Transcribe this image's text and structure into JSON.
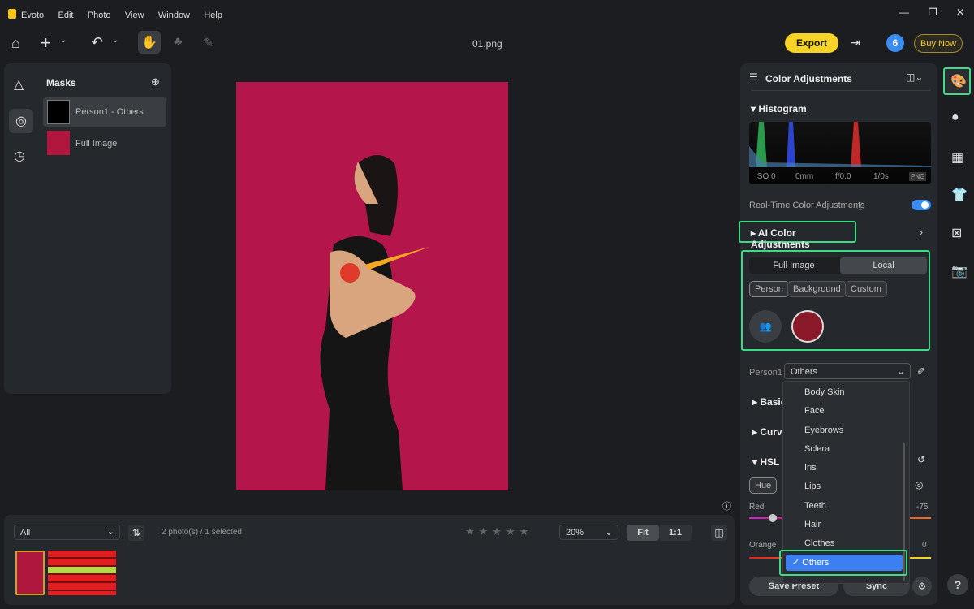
{
  "app": {
    "name": "Evoto",
    "menu": [
      "Edit",
      "Photo",
      "View",
      "Window",
      "Help"
    ],
    "file_name": "01.png"
  },
  "toolbar": {
    "export": "Export",
    "badge": "6",
    "buy_now": "Buy Now",
    "accent": "#f5d327"
  },
  "masks": {
    "title": "Masks",
    "items": [
      {
        "label": "Person1 - Others",
        "selected": true
      },
      {
        "label": "Full Image",
        "selected": false
      }
    ]
  },
  "filmstrip": {
    "filter": "All",
    "count": "2 photo(s) / 1 selected",
    "rating": 0,
    "zoom": "20%",
    "fit": "Fit",
    "one_to_one": "1:1"
  },
  "right": {
    "title": "Color Adjustments",
    "histogram": "Histogram",
    "exif": [
      "ISO 0",
      "0mm",
      "f/0.0",
      "1/0s"
    ],
    "format": "PNG",
    "realtime": "Real-Time Color Adjustments",
    "realtime_on": true,
    "ai_color": "AI Color Adjustments",
    "tabs": [
      "Full Image",
      "Local"
    ],
    "active_tab": "Local",
    "chips": [
      "Person",
      "Background",
      "Custom"
    ],
    "active_chip": "Person",
    "person_label": "Person1",
    "person_value": "Others",
    "sections": {
      "basic": "Basic",
      "curves": "Curves",
      "hsl": "HSL"
    },
    "hue": "Hue",
    "red": {
      "label": "Red",
      "value": "-75"
    },
    "orange": {
      "label": "Orange",
      "value": "0"
    },
    "save_preset": "Save Preset",
    "sync": "Sync",
    "help": "?"
  },
  "dropdown": {
    "items": [
      "Body Skin",
      "Face",
      "Eyebrows",
      "Sclera",
      "Iris",
      "Lips",
      "Teeth",
      "Hair",
      "Clothes",
      "Others"
    ],
    "selected": "Others"
  }
}
